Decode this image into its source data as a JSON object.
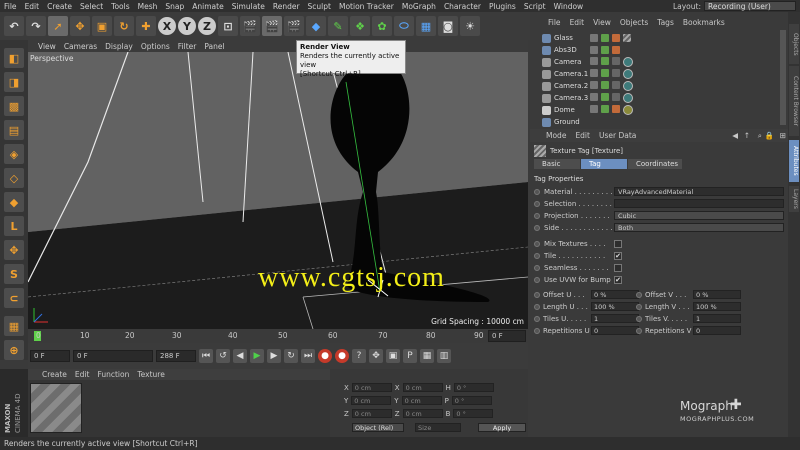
{
  "menubar": {
    "items": [
      "File",
      "Edit",
      "Create",
      "Select",
      "Tools",
      "Mesh",
      "Snap",
      "Animate",
      "Simulate",
      "Render",
      "Sculpt",
      "Motion Tracker",
      "MoGraph",
      "Character",
      "Plugins",
      "Script",
      "Window"
    ],
    "layout_label": "Layout:",
    "layout_value": "Recording (User)"
  },
  "viewport": {
    "menu": [
      "View",
      "Cameras",
      "Display",
      "Options",
      "Filter",
      "Panel"
    ],
    "label": "Perspective",
    "grid_spacing": "Grid Spacing : 10000 cm",
    "watermark": "www.cgtsj.com"
  },
  "tooltip": {
    "title": "Render View",
    "line1": "Renders the currently active view",
    "line2": "[Shortcut Ctrl+R]"
  },
  "timeline": {
    "ticks": [
      "0",
      "10",
      "20",
      "30",
      "40",
      "50",
      "60",
      "70",
      "80",
      "90"
    ],
    "end_field": "0 F"
  },
  "transport": {
    "current": "0 F",
    "start": "0 F",
    "end": "288 F"
  },
  "material": {
    "menu": [
      "Create",
      "Edit",
      "Function",
      "Texture"
    ]
  },
  "coords": {
    "rows": [
      {
        "a": "X",
        "av": "0 cm",
        "b": "X",
        "bv": "0 cm",
        "c": "H",
        "cv": "0 °"
      },
      {
        "a": "Y",
        "av": "0 cm",
        "b": "Y",
        "bv": "0 cm",
        "c": "P",
        "cv": "0 °"
      },
      {
        "a": "Z",
        "av": "0 cm",
        "b": "Z",
        "bv": "0 cm",
        "c": "B",
        "cv": "0 °"
      }
    ],
    "mode": "Object (Rel)",
    "size": "Size",
    "apply": "Apply"
  },
  "branding": {
    "maxon": "MAXON",
    "cinema": "CINEMA 4D",
    "mograph": "Mograph",
    "mograph_sub": "MOGRAPHPLUS.COM"
  },
  "status": "Renders the currently active view [Shortcut Ctrl+R]",
  "objects": {
    "menu": [
      "File",
      "Edit",
      "View",
      "Objects",
      "Tags",
      "Bookmarks"
    ],
    "items": [
      "Glass",
      "Abs3D",
      "Camera",
      "Camera.1",
      "Camera.2",
      "Camera.3",
      "Dome",
      "Ground"
    ]
  },
  "right_tabs": [
    "Objects",
    "Content Browser",
    "Attributes",
    "Layers"
  ],
  "attributes": {
    "menu": [
      "Mode",
      "Edit",
      "User Data"
    ],
    "title": "Texture Tag [Texture]",
    "tabs": [
      "Basic",
      "Tag",
      "Coordinates"
    ],
    "section": "Tag Properties",
    "props": [
      {
        "label": "Material . . . . . . . . .",
        "value": "VRayAdvancedMaterial"
      },
      {
        "label": "Selection . . . . . . . . .",
        "value": ""
      },
      {
        "label": "Projection . . . . . . .",
        "value": "Cubic"
      },
      {
        "label": "Side . . . . . . . . . . . .",
        "value": "Both"
      }
    ],
    "checks": [
      {
        "label": "Mix Textures . . . .",
        "value": ""
      },
      {
        "label": "Tile . . . . . . . . . . .",
        "value": "✔"
      },
      {
        "label": "Seamless . . . . . . .",
        "value": ""
      },
      {
        "label": "Use UVW for Bump",
        "value": "✔"
      }
    ],
    "pairs": [
      {
        "l1": "Offset U . . .",
        "v1": "0 %",
        "l2": "Offset V . . .",
        "v2": "0 %"
      },
      {
        "l1": "Length U . . .",
        "v1": "100 %",
        "l2": "Length V . . .",
        "v2": "100 %"
      },
      {
        "l1": "Tiles U. . . . .",
        "v1": "1",
        "l2": "Tiles V. . . . .",
        "v2": "1"
      },
      {
        "l1": "Repetitions U",
        "v1": "0",
        "l2": "Repetitions V",
        "v2": "0"
      }
    ]
  },
  "colors": {
    "accent": "#6c8fc0",
    "watermark": "#f3ee18",
    "record": "#c53a2a"
  }
}
